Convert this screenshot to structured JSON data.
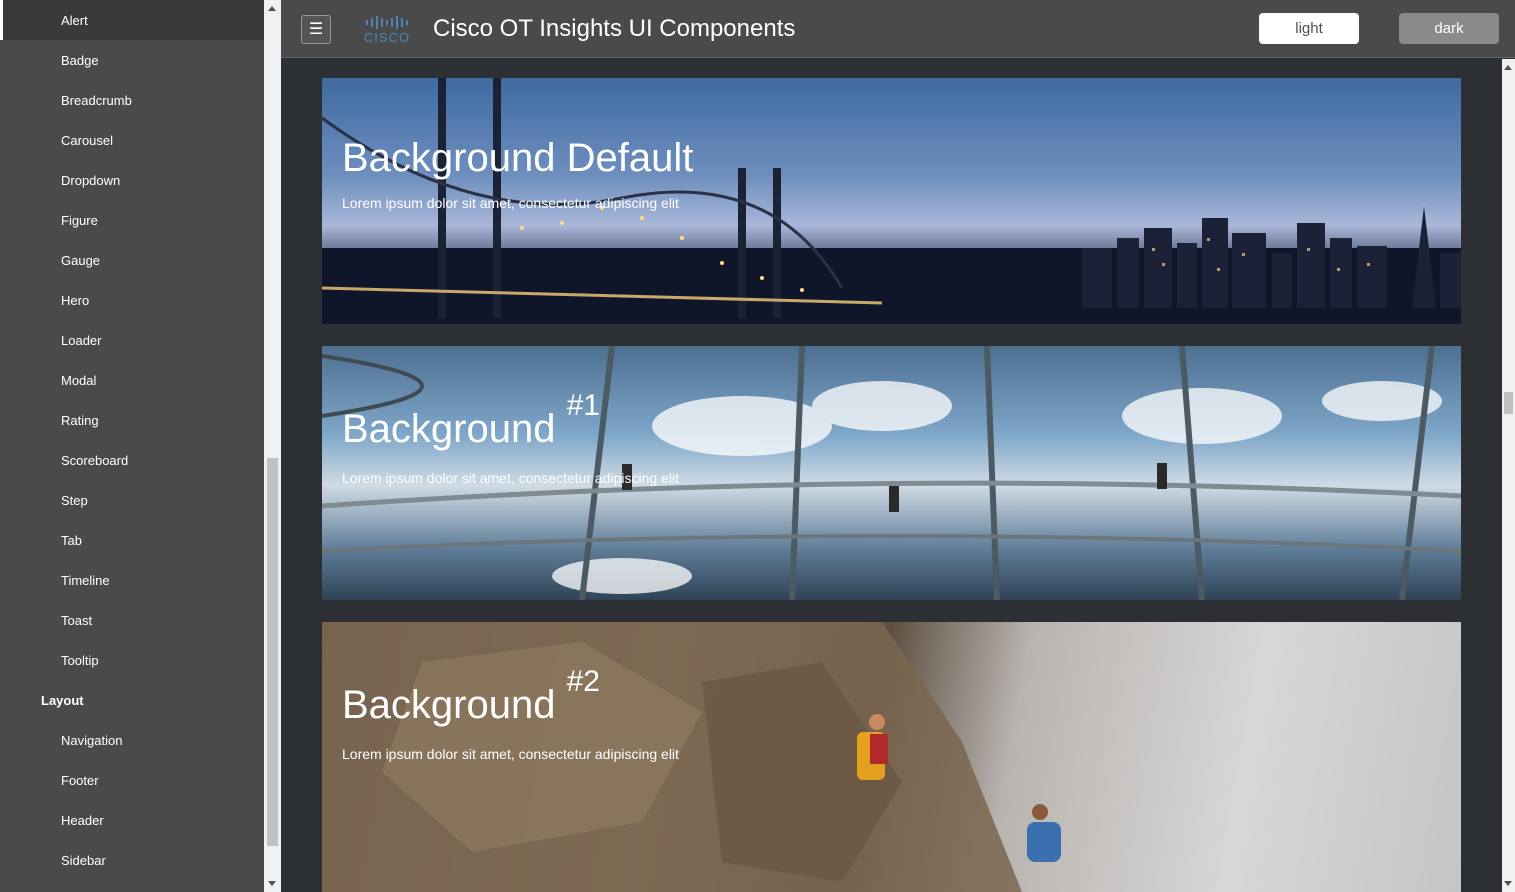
{
  "sidebar": {
    "items": [
      {
        "label": "Alert",
        "active": true
      },
      {
        "label": "Badge"
      },
      {
        "label": "Breadcrumb"
      },
      {
        "label": "Carousel"
      },
      {
        "label": "Dropdown"
      },
      {
        "label": "Figure"
      },
      {
        "label": "Gauge"
      },
      {
        "label": "Hero"
      },
      {
        "label": "Loader"
      },
      {
        "label": "Modal"
      },
      {
        "label": "Rating"
      },
      {
        "label": "Scoreboard"
      },
      {
        "label": "Step"
      },
      {
        "label": "Tab"
      },
      {
        "label": "Timeline"
      },
      {
        "label": "Toast"
      },
      {
        "label": "Tooltip"
      }
    ],
    "section_layout": "Layout",
    "layout_items": [
      {
        "label": "Navigation"
      },
      {
        "label": "Footer"
      },
      {
        "label": "Header"
      },
      {
        "label": "Sidebar"
      }
    ]
  },
  "header": {
    "menu_icon": "hamburger-menu-icon",
    "logo_text": "CISCO",
    "title": "Cisco OT Insights UI Components",
    "light_label": "light",
    "dark_label": "dark"
  },
  "heroes": [
    {
      "title": "Background Default",
      "sup": "",
      "subtitle": "Lorem ipsum dolor sit amet, consectetur adipiscing elit"
    },
    {
      "title": "Background ",
      "sup": "#1",
      "subtitle": "Lorem ipsum dolor sit amet, consectetur adipiscing elit"
    },
    {
      "title": "Background ",
      "sup": "#2",
      "subtitle": "Lorem ipsum dolor sit amet, consectetur adipiscing elit"
    }
  ],
  "colors": {
    "sidebar_bg": "#4a4a4a",
    "header_bg": "#4a4a4a",
    "main_bg": "#2c2f33",
    "cisco_blue": "#4d86b5"
  }
}
